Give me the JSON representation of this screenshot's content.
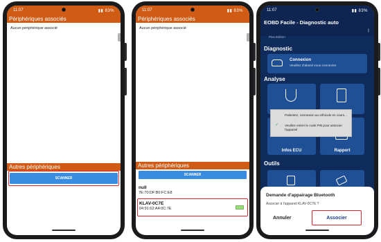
{
  "phone1": {
    "time": "11:07",
    "battery": "83%",
    "header_paired": "Périphériques associés",
    "no_paired": "Aucun périphérique associé",
    "header_other": "Autres périphériques",
    "scan_button": "SCANNER"
  },
  "phone2": {
    "time": "11:07",
    "battery": "83%",
    "header_paired": "Périphériques associés",
    "no_paired": "Aucun périphérique associé",
    "header_other": "Autres périphériques",
    "scan_button": "SCANNER",
    "devices": [
      {
        "name": "null",
        "mac": "7E:70:DF:B0:FC:E8"
      },
      {
        "name": "KLAV-0C7E",
        "mac": "04:91:62:A4:0C:7E"
      }
    ]
  },
  "phone3": {
    "time": "11:07",
    "battery": "83%",
    "app_title": "EOBD Facile - Diagnostic auto",
    "edition": "Plus Edition",
    "diagnostic_title": "Diagnostic",
    "connexion_label": "Connexion",
    "connexion_sub": "Veuillez d'abord vous connecter",
    "analyse_title": "Analyse",
    "infos_ecu": "Infos ECU",
    "rapport": "Rapport",
    "outils_title": "Outils",
    "wait_line1": "Patientez, connexion au véhicule en cours...",
    "wait_line2": "Veuillez entrer le code PIN pour associer l'appareil",
    "bt_title": "Demande d'appairage Bluetooth",
    "bt_message": "Associer à l'appareil KLAV-0C7E ?",
    "cancel": "Annuler",
    "accept": "Associer"
  },
  "colors": {
    "orange": "#cf5b14",
    "blue_button": "#3a8ce0",
    "highlight_red": "#d7262e",
    "app_navy": "#0f2b5c"
  }
}
